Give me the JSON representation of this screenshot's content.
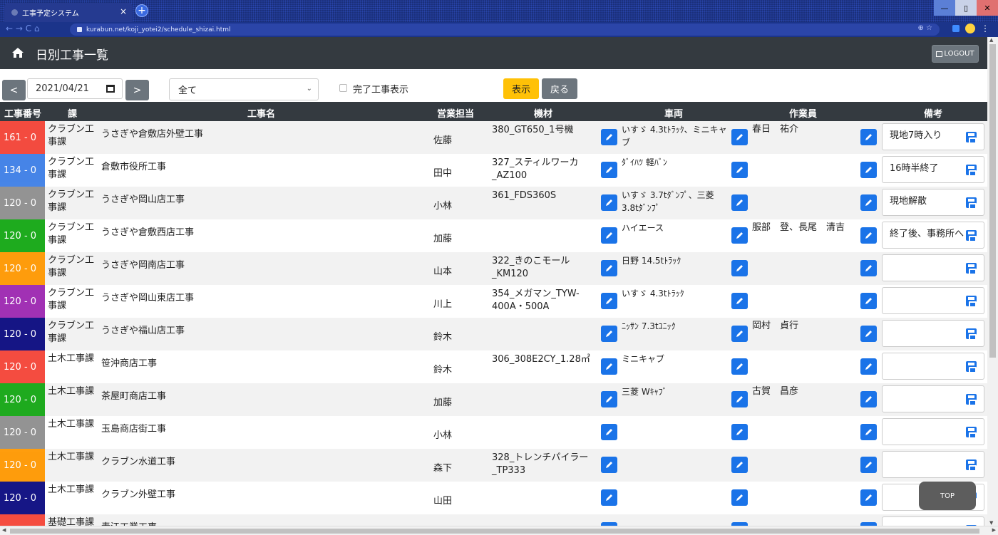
{
  "browser": {
    "tab_title": "工事予定システム",
    "tab_close": "×",
    "new_tab": "+",
    "url": "kurabun.net/koji_yotei2/schedule_shizai.html",
    "nav_icons": "←  →  C  ⌂",
    "omni_icons": "⊕  ☆",
    "menu_icon": "⋮",
    "win_min": "—",
    "win_max": "▯",
    "win_close": "✕"
  },
  "header": {
    "title": "日別工事一覧",
    "logout": "LOGOUT"
  },
  "toolbar": {
    "prev": "<",
    "next": ">",
    "date": "2021/04/21",
    "select_value": "全て",
    "checkbox_label": "完了工事表示",
    "show_button": "表示",
    "back_button": "戻る"
  },
  "columns": {
    "number": "工事番号",
    "ka": "課",
    "name": "工事名",
    "eigyo": "営業担当",
    "kizai": "機材",
    "sharyo": "車両",
    "sagyoin": "作業員",
    "biko": "備考"
  },
  "rows": [
    {
      "number": "161 - 0",
      "color": "#f44336",
      "ka": "クラブン工事課",
      "name": "うさぎや倉敷店外壁工事",
      "eigyo": "佐藤",
      "kizai": "380_GT650_1号機",
      "sharyo": "いすゞ 4.3tﾄﾗｯｸ、ミニキャブ",
      "sagyoin": "春日　祐介",
      "biko": "現地7時入り"
    },
    {
      "number": "134 - 0",
      "color": "#3d7ee6",
      "ka": "クラブン工事課",
      "name": "倉敷市役所工事",
      "eigyo": "田中",
      "kizai": "327_スティルワーカ_AZ100",
      "sharyo": "ﾀﾞｲﾊﾂ 軽ﾊﾞﾝ",
      "sagyoin": "",
      "biko": "16時半終了"
    },
    {
      "number": "120 - 0",
      "color": "#8e8e8e",
      "ka": "クラブン工事課",
      "name": "うさぎや岡山店工事",
      "eigyo": "小林",
      "kizai": "361_FDS360S",
      "sharyo": "いすゞ 3.7tﾀﾞﾝﾌﾟ、三菱 3.8tﾀﾞﾝﾌﾟ",
      "sagyoin": "",
      "biko": "現地解散"
    },
    {
      "number": "120 - 0",
      "color": "#13a713",
      "ka": "クラブン工事課",
      "name": "うさぎや倉敷西店工事",
      "eigyo": "加藤",
      "kizai": "",
      "sharyo": "ハイエース",
      "sagyoin": "服部　登、長尾　清吉",
      "biko": "終了後、事務所へ"
    },
    {
      "number": "120 - 0",
      "color": "#ff9800",
      "ka": "クラブン工事課",
      "name": "うさぎや岡南店工事",
      "eigyo": "山本",
      "kizai": "322_きのこモール_KM120",
      "sharyo": "日野 14.5tﾄﾗｯｸ",
      "sagyoin": "",
      "biko": ""
    },
    {
      "number": "120 - 0",
      "color": "#9c27b0",
      "ka": "クラブン工事課",
      "name": "うさぎや岡山東店工事",
      "eigyo": "川上",
      "kizai": "354_メガマン_TYW-400A・500A",
      "sharyo": "いすゞ 4.3tﾄﾗｯｸ",
      "sagyoin": "",
      "biko": ""
    },
    {
      "number": "120 - 0",
      "color": "#0a0a80",
      "ka": "クラブン工事課",
      "name": "うさぎや福山店工事",
      "eigyo": "鈴木",
      "kizai": "",
      "sharyo": "ﾆｯｻﾝ 7.3tﾕﾆｯｸ",
      "sagyoin": "岡村　貞行",
      "biko": ""
    },
    {
      "number": "120 - 0",
      "color": "#f44336",
      "ka": "土木工事課",
      "name": "笹沖商店工事",
      "eigyo": "鈴木",
      "kizai": "306_308E2CY_1.28㎥",
      "sharyo": "ミニキャブ",
      "sagyoin": "",
      "biko": ""
    },
    {
      "number": "120 - 0",
      "color": "#13a713",
      "ka": "土木工事課",
      "name": "茶屋町商店工事",
      "eigyo": "加藤",
      "kizai": "",
      "sharyo": "三菱 Wｷｬﾌﾞ",
      "sagyoin": "古賀　昌彦",
      "biko": ""
    },
    {
      "number": "120 - 0",
      "color": "#8e8e8e",
      "ka": "土木工事課",
      "name": "玉島商店街工事",
      "eigyo": "小林",
      "kizai": "",
      "sharyo": "",
      "sagyoin": "",
      "biko": ""
    },
    {
      "number": "120 - 0",
      "color": "#ff9800",
      "ka": "土木工事課",
      "name": "クラブン水道工事",
      "eigyo": "森下",
      "kizai": "328_トレンチパイラー_TP333",
      "sharyo": "",
      "sagyoin": "",
      "biko": ""
    },
    {
      "number": "120 - 0",
      "color": "#0a0a80",
      "ka": "土木工事課",
      "name": "クラブン外壁工事",
      "eigyo": "山田",
      "kizai": "",
      "sharyo": "",
      "sagyoin": "",
      "biko": ""
    },
    {
      "number": "",
      "color": "#f44336",
      "ka": "基礎工事課",
      "name": "青江工業工事",
      "eigyo": "",
      "kizai": "",
      "sharyo": "",
      "sagyoin": "",
      "biko": ""
    }
  ],
  "top_button": "TOP"
}
